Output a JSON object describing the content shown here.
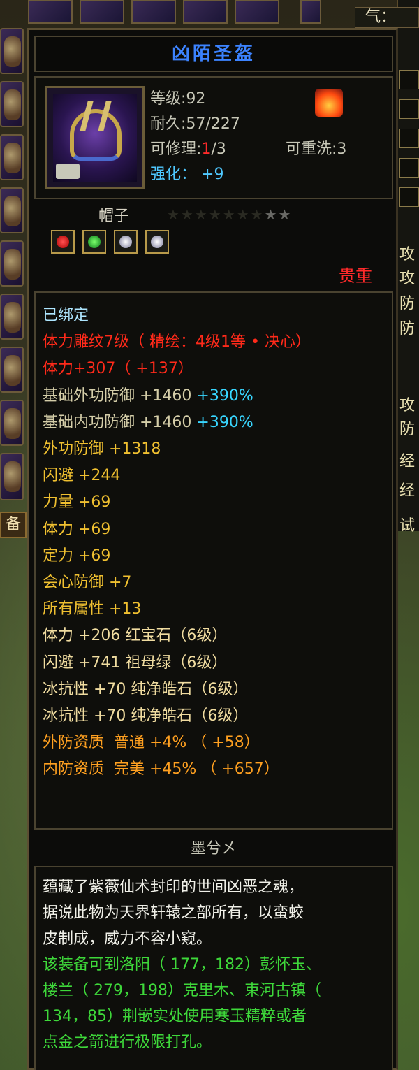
{
  "hud": {
    "qi_label": "气：",
    "left_tab_label": "备",
    "right_labels": [
      "攻",
      "攻",
      "防",
      "防",
      "攻",
      "防",
      "经",
      "经",
      "试"
    ]
  },
  "item": {
    "name": "凶陌圣盔",
    "level_label": "等级",
    "level_value": ":92",
    "durability_label": "耐久",
    "durability_value": ":57/227",
    "repair_label": "可修理",
    "repair_sep": ":",
    "repair_current": "1",
    "repair_max": "/3",
    "rewash_label": "可重洗",
    "rewash_value": ":3",
    "enhance_label": "强化",
    "enhance_value": "+9",
    "type": "帽子",
    "stars_total": 9,
    "stars_lit": 2,
    "rarity": "贵重"
  },
  "attributes": [
    {
      "text": "已绑定",
      "color": "bound"
    },
    {
      "text": "体力雕纹7级（ 精绘：4级1等 • 决心）",
      "color": "red"
    },
    {
      "text": "体力+307（ +137）",
      "color": "red"
    },
    {
      "text": "基础外功防御 +1460",
      "extra": " +390%",
      "color": "base"
    },
    {
      "text": "基础内功防御 +1460",
      "extra": " +390%",
      "color": "base"
    },
    {
      "text": "外功防御 +1318",
      "color": "yellow"
    },
    {
      "text": "闪避 +244",
      "color": "yellow"
    },
    {
      "text": "力量 +69",
      "color": "yellow"
    },
    {
      "text": "体力 +69",
      "color": "yellow"
    },
    {
      "text": "定力 +69",
      "color": "yellow"
    },
    {
      "text": "会心防御 +7",
      "color": "yellow"
    },
    {
      "text": "所有属性 +13",
      "color": "yellow"
    },
    {
      "text": "体力 +206 红宝石（6级）",
      "color": "gem"
    },
    {
      "text": "闪避 +741 祖母绿（6级）",
      "color": "gem"
    },
    {
      "text": "冰抗性 +70 纯净皓石（6级）",
      "color": "gem"
    },
    {
      "text": "冰抗性 +70 纯净皓石（6级）",
      "color": "gem"
    },
    {
      "text": "外防资质  普通 +4% （ +58）",
      "color": "orange"
    },
    {
      "text": "内防资质  完美 +45% （ +657）",
      "color": "orange"
    }
  ],
  "author": "墨兮㐅",
  "description": {
    "lore": [
      "蕴藏了紫薇仙术封印的世间凶恶之魂，",
      "据说此物为天界轩辕之部所有，以蛮蛟",
      "皮制成，威力不容小窥。"
    ],
    "hint": [
      "该装备可到洛阳（ 177，182）彭怀玉、",
      "楼兰（ 279，198）克里木、束河古镇（",
      "134，85）荆嵌实处使用寒玉精粹或者",
      "点金之箭进行极限打孔。"
    ]
  },
  "colors": {
    "title": "#3c83ff",
    "rarity": "#ff2a2a",
    "hint": "#3ed83a"
  }
}
